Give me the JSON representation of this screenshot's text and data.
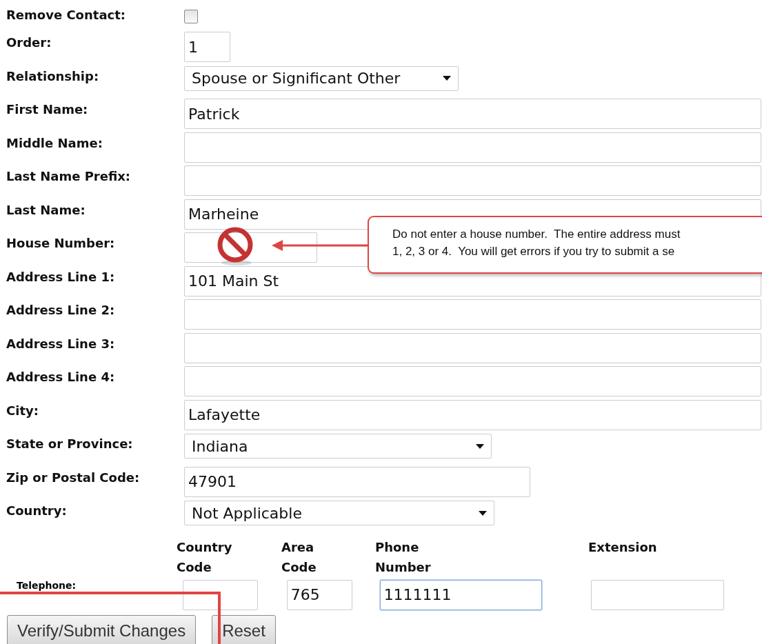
{
  "fields": [
    {
      "kind": "checkbox",
      "label": "Remove Contact:",
      "checked": false
    },
    {
      "kind": "text",
      "label": "Order:",
      "value": "1"
    },
    {
      "kind": "select",
      "label": "Relationship:",
      "value": "Spouse or Significant Other"
    },
    {
      "kind": "text",
      "label": "First Name:",
      "value": "Patrick"
    },
    {
      "kind": "text",
      "label": "Middle Name:"
    },
    {
      "kind": "text",
      "label": "Last Name Prefix:"
    },
    {
      "kind": "text",
      "label": "Last Name:",
      "value": "Marheine"
    },
    {
      "kind": "text",
      "label": "House Number:",
      "blocked": true
    },
    {
      "kind": "text",
      "label": "Address Line 1:",
      "value": "101 Main St"
    },
    {
      "kind": "text",
      "label": "Address Line 2:"
    },
    {
      "kind": "text",
      "label": "Address Line 3:"
    },
    {
      "kind": "text",
      "label": "Address Line 4:"
    },
    {
      "kind": "text",
      "label": "City:",
      "value": "Lafayette"
    },
    {
      "kind": "select",
      "label": "State or Province:",
      "value": "Indiana"
    },
    {
      "kind": "text",
      "label": "Zip or Postal Code:",
      "value": "47901"
    },
    {
      "kind": "select",
      "label": "Country:",
      "value": "Not Applicable"
    }
  ],
  "callout": {
    "lines": [
      "Do not enter a house number.  The entire address must",
      "1, 2, 3 or 4.  You will get errors if you try to submit a se"
    ]
  },
  "telephone": {
    "label": "Telephone:",
    "parts": [
      {
        "header": [
          "Country",
          "Code"
        ],
        "focused": false
      },
      {
        "header": [
          "Area",
          "Code"
        ],
        "value": "765",
        "focused": false
      },
      {
        "header": [
          "Phone",
          "Number"
        ],
        "value": "1111111",
        "focused": true
      },
      {
        "header": [
          "Extension"
        ],
        "focused": false
      }
    ]
  },
  "buttons": [
    "Verify/Submit Changes",
    "Reset"
  ]
}
